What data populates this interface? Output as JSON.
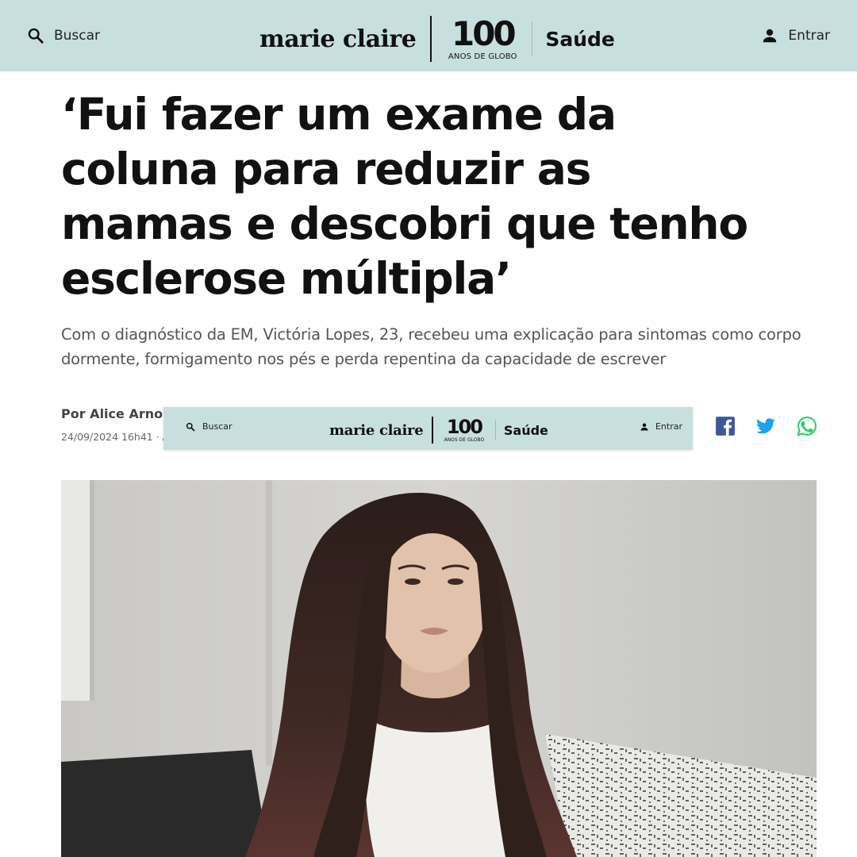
{
  "header": {
    "search_label": "Buscar",
    "brand": "marie claire",
    "badge_number": "100",
    "badge_caption": "ANOS DE GLOBO",
    "section": "Saúde",
    "login_label": "Entrar",
    "background_color": "#c8dfdf"
  },
  "article": {
    "headline": "‘Fui fazer um exame da coluna para reduzir as mamas e descobri que tenho esclerose múltipla’",
    "subtitle": "Com o diagnóstico da EM, Victória Lopes, 23, recebeu uma explicação para sintomas como corpo dormente, formigamento nos pés e perda repentina da capacidade de escrever",
    "author": "Por Alice Arnold",
    "date": "24/09/2024 16h41 · At"
  },
  "sticky_header": {
    "search_label": "Buscar",
    "brand": "marie claire",
    "badge_number": "100",
    "badge_caption": "ANOS DE GLOBO",
    "section": "Saúde",
    "login_label": "Entrar"
  },
  "share": {
    "icons": [
      "facebook-icon",
      "twitter-icon",
      "whatsapp-icon"
    ],
    "facebook_color": "#3b5998",
    "twitter_color": "#1da1f2",
    "whatsapp_color": "#25d366"
  }
}
